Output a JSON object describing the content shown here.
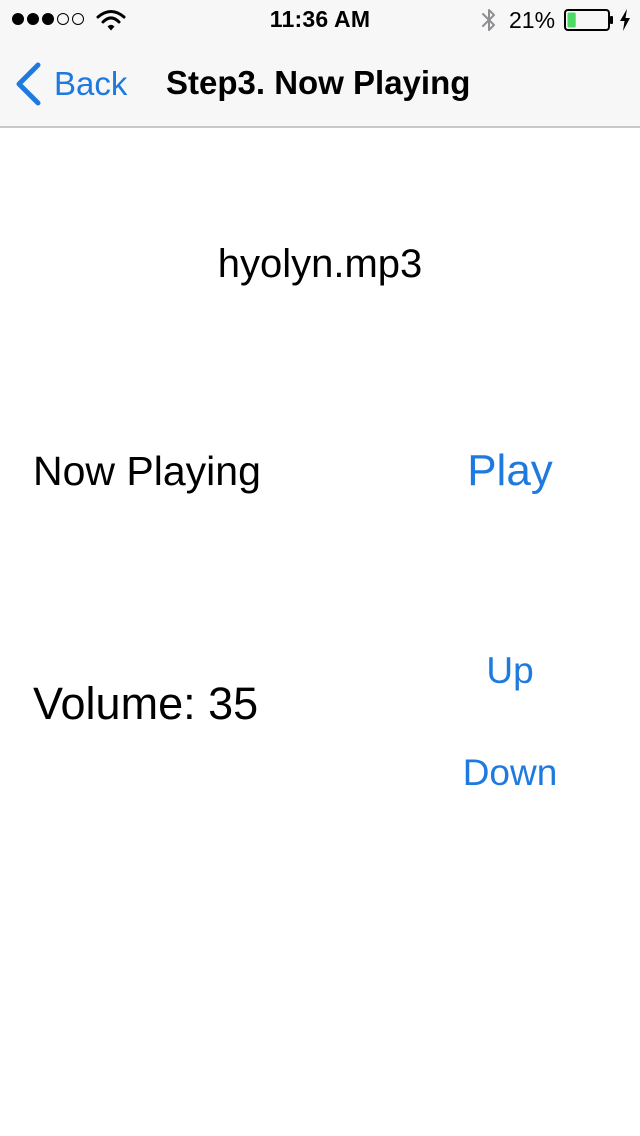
{
  "status_bar": {
    "signal_dots_filled": 3,
    "signal_dots_total": 5,
    "time": "11:36 AM",
    "battery_percent": "21%",
    "battery_level": 0.21,
    "icons": [
      "wifi-icon",
      "bluetooth-icon",
      "battery-icon",
      "charging-bolt-icon"
    ]
  },
  "nav": {
    "back_label": "Back",
    "title": "Step3. Now Playing",
    "back_icon": "chevron-left-icon"
  },
  "player": {
    "file_name": "hyolyn.mp3",
    "status_label": "Now Playing",
    "play_label": "Play",
    "volume_label": "Volume: 35",
    "up_label": "Up",
    "down_label": "Down"
  },
  "colors": {
    "accent": "#1f7ae0",
    "nav_background": "#f7f7f8",
    "battery_fill": "#4cd964"
  }
}
